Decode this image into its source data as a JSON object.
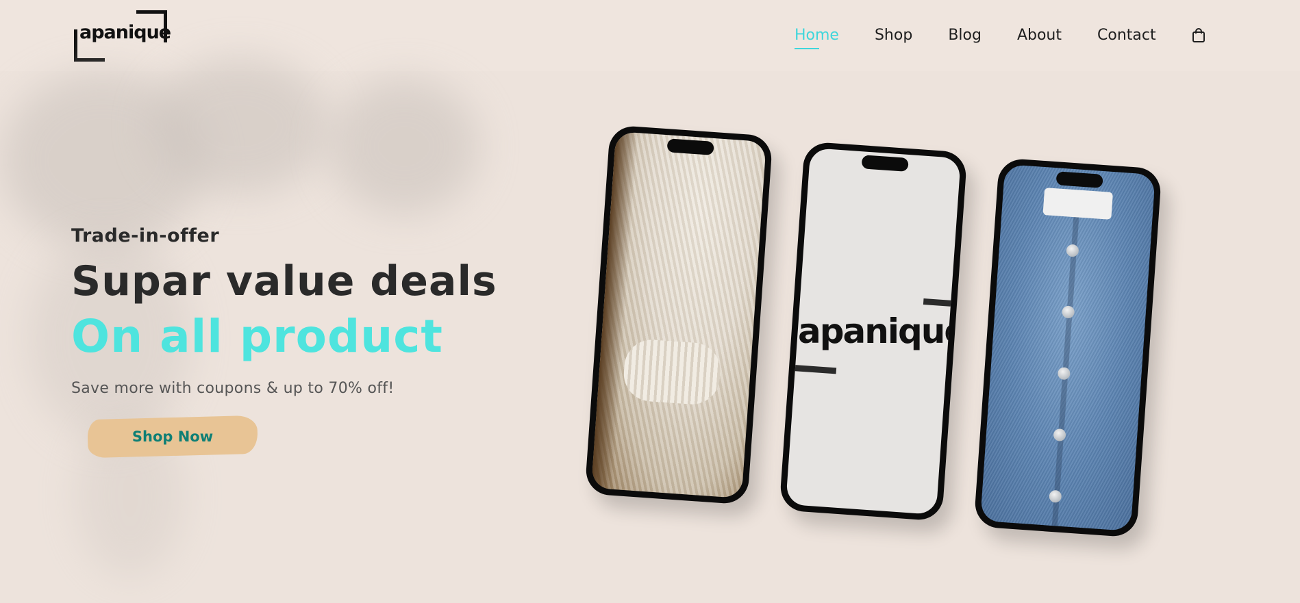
{
  "brand": {
    "logo_text": "apanique"
  },
  "nav": {
    "items": [
      {
        "label": "Home",
        "active": true
      },
      {
        "label": "Shop",
        "active": false
      },
      {
        "label": "Blog",
        "active": false
      },
      {
        "label": "About",
        "active": false
      },
      {
        "label": "Contact",
        "active": false
      }
    ],
    "cart_icon": "shopping-bag-icon"
  },
  "hero": {
    "eyebrow": "Trade-in-offer",
    "headline": "Supar value deals",
    "headline_highlight": "On all product",
    "subtext": "Save more with coupons & up to 70% off!",
    "cta_label": "Shop Now"
  },
  "phones": {
    "brand_screen_text": "apanique"
  },
  "colors": {
    "accent": "#4ee4de",
    "cta_text": "#0e7f75",
    "cta_brush": "#e8c495",
    "background": "#efe5de"
  }
}
